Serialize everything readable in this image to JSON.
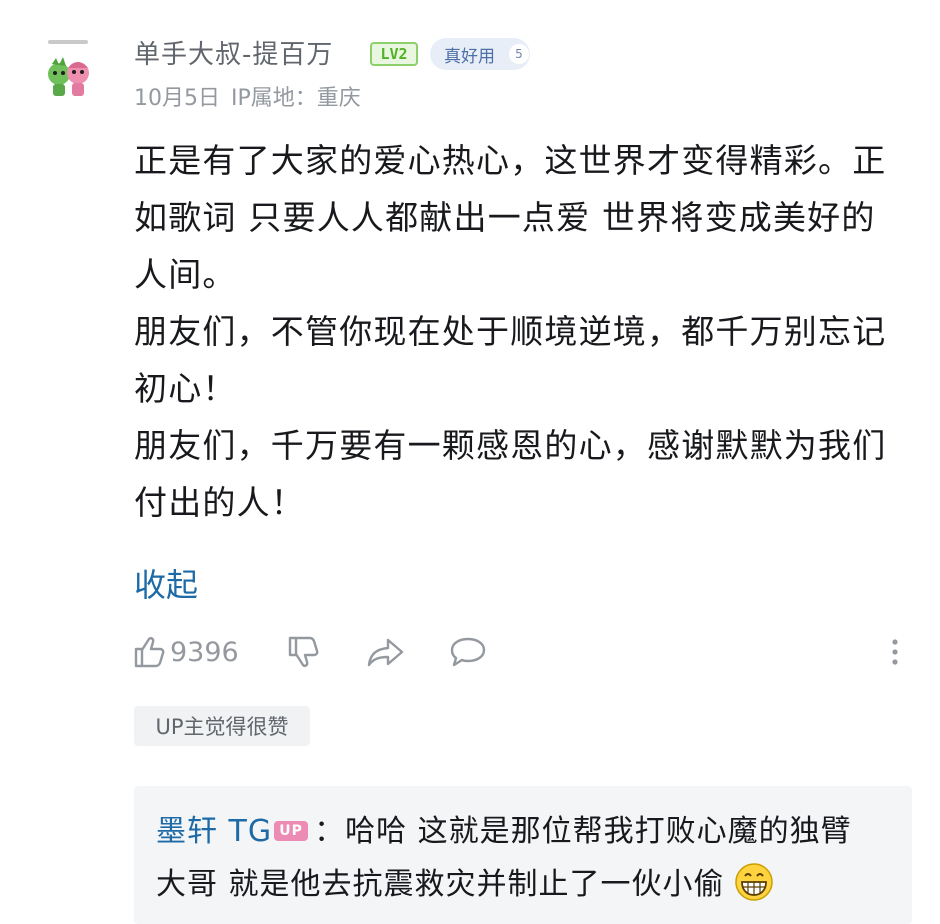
{
  "comment": {
    "username": "单手大叔-提百万",
    "level_badge": "LV2",
    "fan_badge": {
      "name": "真好用",
      "level": "5"
    },
    "meta": "10月5日 IP属地：重庆",
    "lines": [
      "正是有了大家的爱心热心，这世界才变得精彩。正",
      "如歌词 只要人人都献出一点爱 世界将变成美好的",
      "人间。",
      "朋友们，不管你现在处于顺境逆境，都千万别忘记",
      "初心！",
      "朋友们，千万要有一颗感恩的心，感谢默默为我们",
      "付出的人！"
    ],
    "collapse_label": "收起",
    "like_count": "9396",
    "up_liked_tag": "UP主觉得很赞"
  },
  "reply": {
    "user": "墨轩 TG",
    "up_badge": "UP",
    "line1": "：哈哈 这就是那位帮我打败心魔的独臂",
    "line2": "大哥 就是他去抗震救灾并制止了一伙小偷"
  },
  "icons": [
    "like-icon",
    "dislike-icon",
    "share-icon",
    "reply-icon",
    "more-icon",
    "grin-emoji-icon"
  ],
  "colors": {
    "link": "#1e6aa6",
    "meta": "#9499a0",
    "level": "#52b126",
    "up_badge": "#ec8cb4"
  }
}
